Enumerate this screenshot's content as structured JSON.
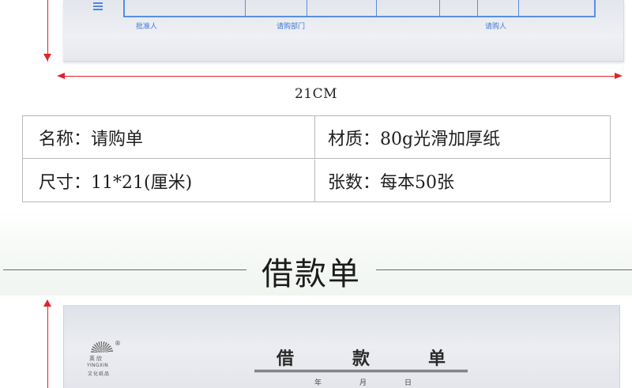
{
  "top_form": {
    "labels": [
      "批准人",
      "请购部门",
      "请购人"
    ]
  },
  "dimension": {
    "width_label": "21CM"
  },
  "specs": {
    "rows": [
      [
        {
          "key": "名称：",
          "value": "请购单"
        },
        {
          "key": "材质：",
          "value": "80g光滑加厚纸"
        }
      ],
      [
        {
          "key": "尺寸：",
          "value": "11*21(厘米)"
        },
        {
          "key": "张数：",
          "value": "每本50张"
        }
      ]
    ]
  },
  "section": {
    "title": "借款单"
  },
  "bottom_form": {
    "logo": {
      "mark": "®",
      "name": "英欣",
      "latin": "YINGXIN",
      "sub": "文化纸品"
    },
    "title_chars": [
      "借",
      "款",
      "单"
    ],
    "date_labels": [
      "年",
      "月",
      "日"
    ]
  },
  "colors": {
    "dimension_arrow": "#e0232a",
    "form_ink_blue": "#3f78d4"
  }
}
